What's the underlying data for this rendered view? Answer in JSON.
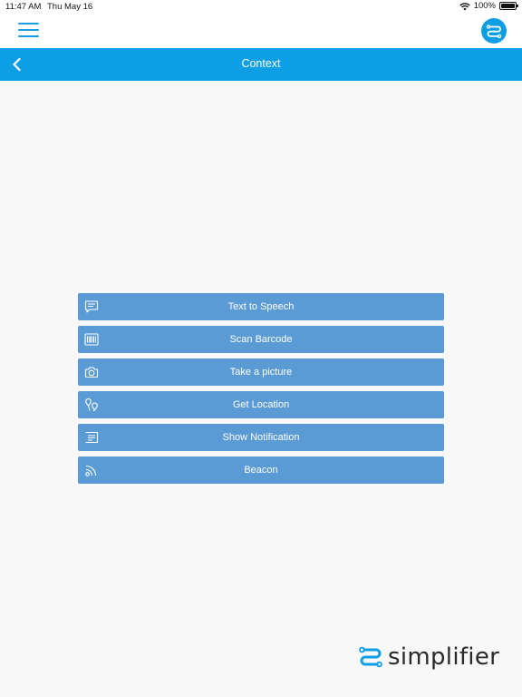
{
  "status_bar": {
    "time": "11:47 AM",
    "date": "Thu May 16",
    "battery_percent": "100%",
    "wifi_icon": "wifi-icon",
    "battery_icon": "battery-icon"
  },
  "header": {
    "menu_icon": "hamburger-menu-icon",
    "avatar_icon": "simplifier-logo-icon"
  },
  "nav": {
    "title": "Context",
    "back_icon": "chevron-left-icon"
  },
  "actions": [
    {
      "label": "Text to Speech",
      "icon": "speech-bubble-icon"
    },
    {
      "label": "Scan Barcode",
      "icon": "barcode-icon"
    },
    {
      "label": "Take a picture",
      "icon": "camera-icon"
    },
    {
      "label": "Get Location",
      "icon": "location-icon"
    },
    {
      "label": "Show Notification",
      "icon": "notification-icon"
    },
    {
      "label": "Beacon",
      "icon": "beacon-icon"
    }
  ],
  "brand": {
    "name": "simplifier",
    "primary_color": "#0d9ee3",
    "button_color": "#5b9bd5"
  }
}
